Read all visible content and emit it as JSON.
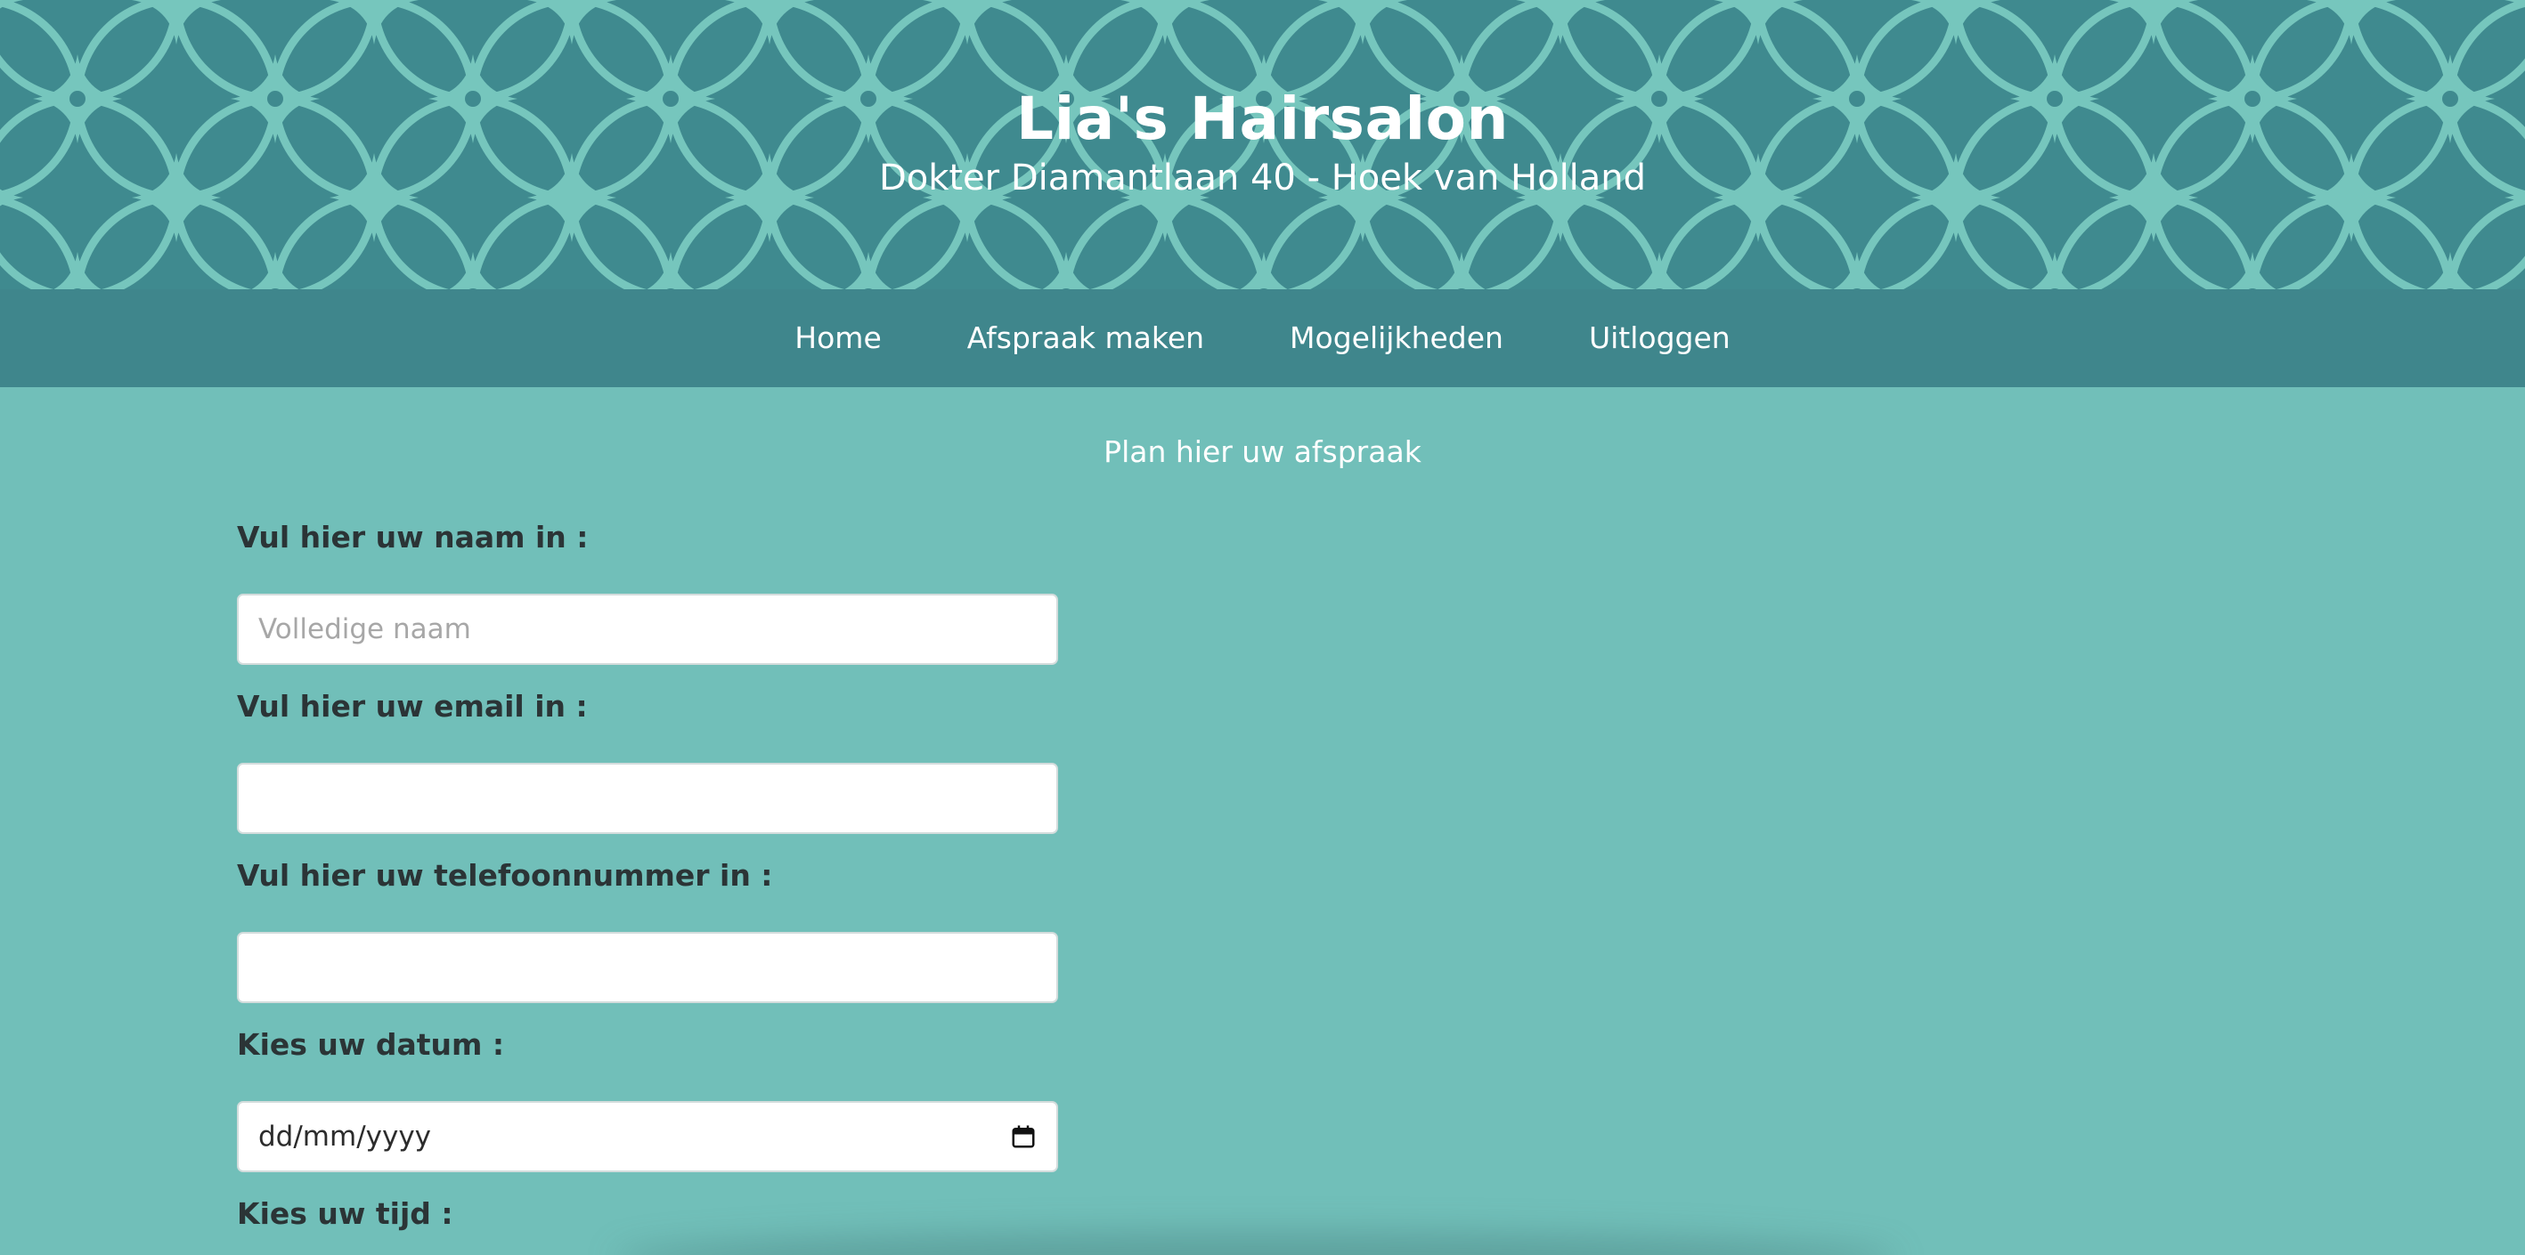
{
  "header": {
    "title": "Lia's Hairsalon",
    "subtitle": "Dokter Diamantlaan 40 - Hoek van Holland",
    "pattern_colors": {
      "dark": "#3f8a8f",
      "light": "#76c6bd"
    }
  },
  "nav": {
    "items": [
      {
        "label": "Home"
      },
      {
        "label": "Afspraak maken"
      },
      {
        "label": "Mogelijkheden"
      },
      {
        "label": "Uitloggen"
      }
    ]
  },
  "form": {
    "intro": "Plan hier uw afspraak",
    "name_label": "Vul hier uw naam in :",
    "name_placeholder": "Volledige naam",
    "name_value": "",
    "email_label": "Vul hier uw email in :",
    "email_value": "",
    "phone_label": "Vul hier uw telefoonnummer in :",
    "phone_value": "",
    "date_label": "Kies uw datum :",
    "date_display": "dd/mm/yyyy",
    "date_icon": "calendar-icon",
    "time_label": "Kies uw tijd :"
  },
  "colors": {
    "page_background": "#71bfb9",
    "nav_background": "#3f868c",
    "label_text": "#2b3436"
  }
}
